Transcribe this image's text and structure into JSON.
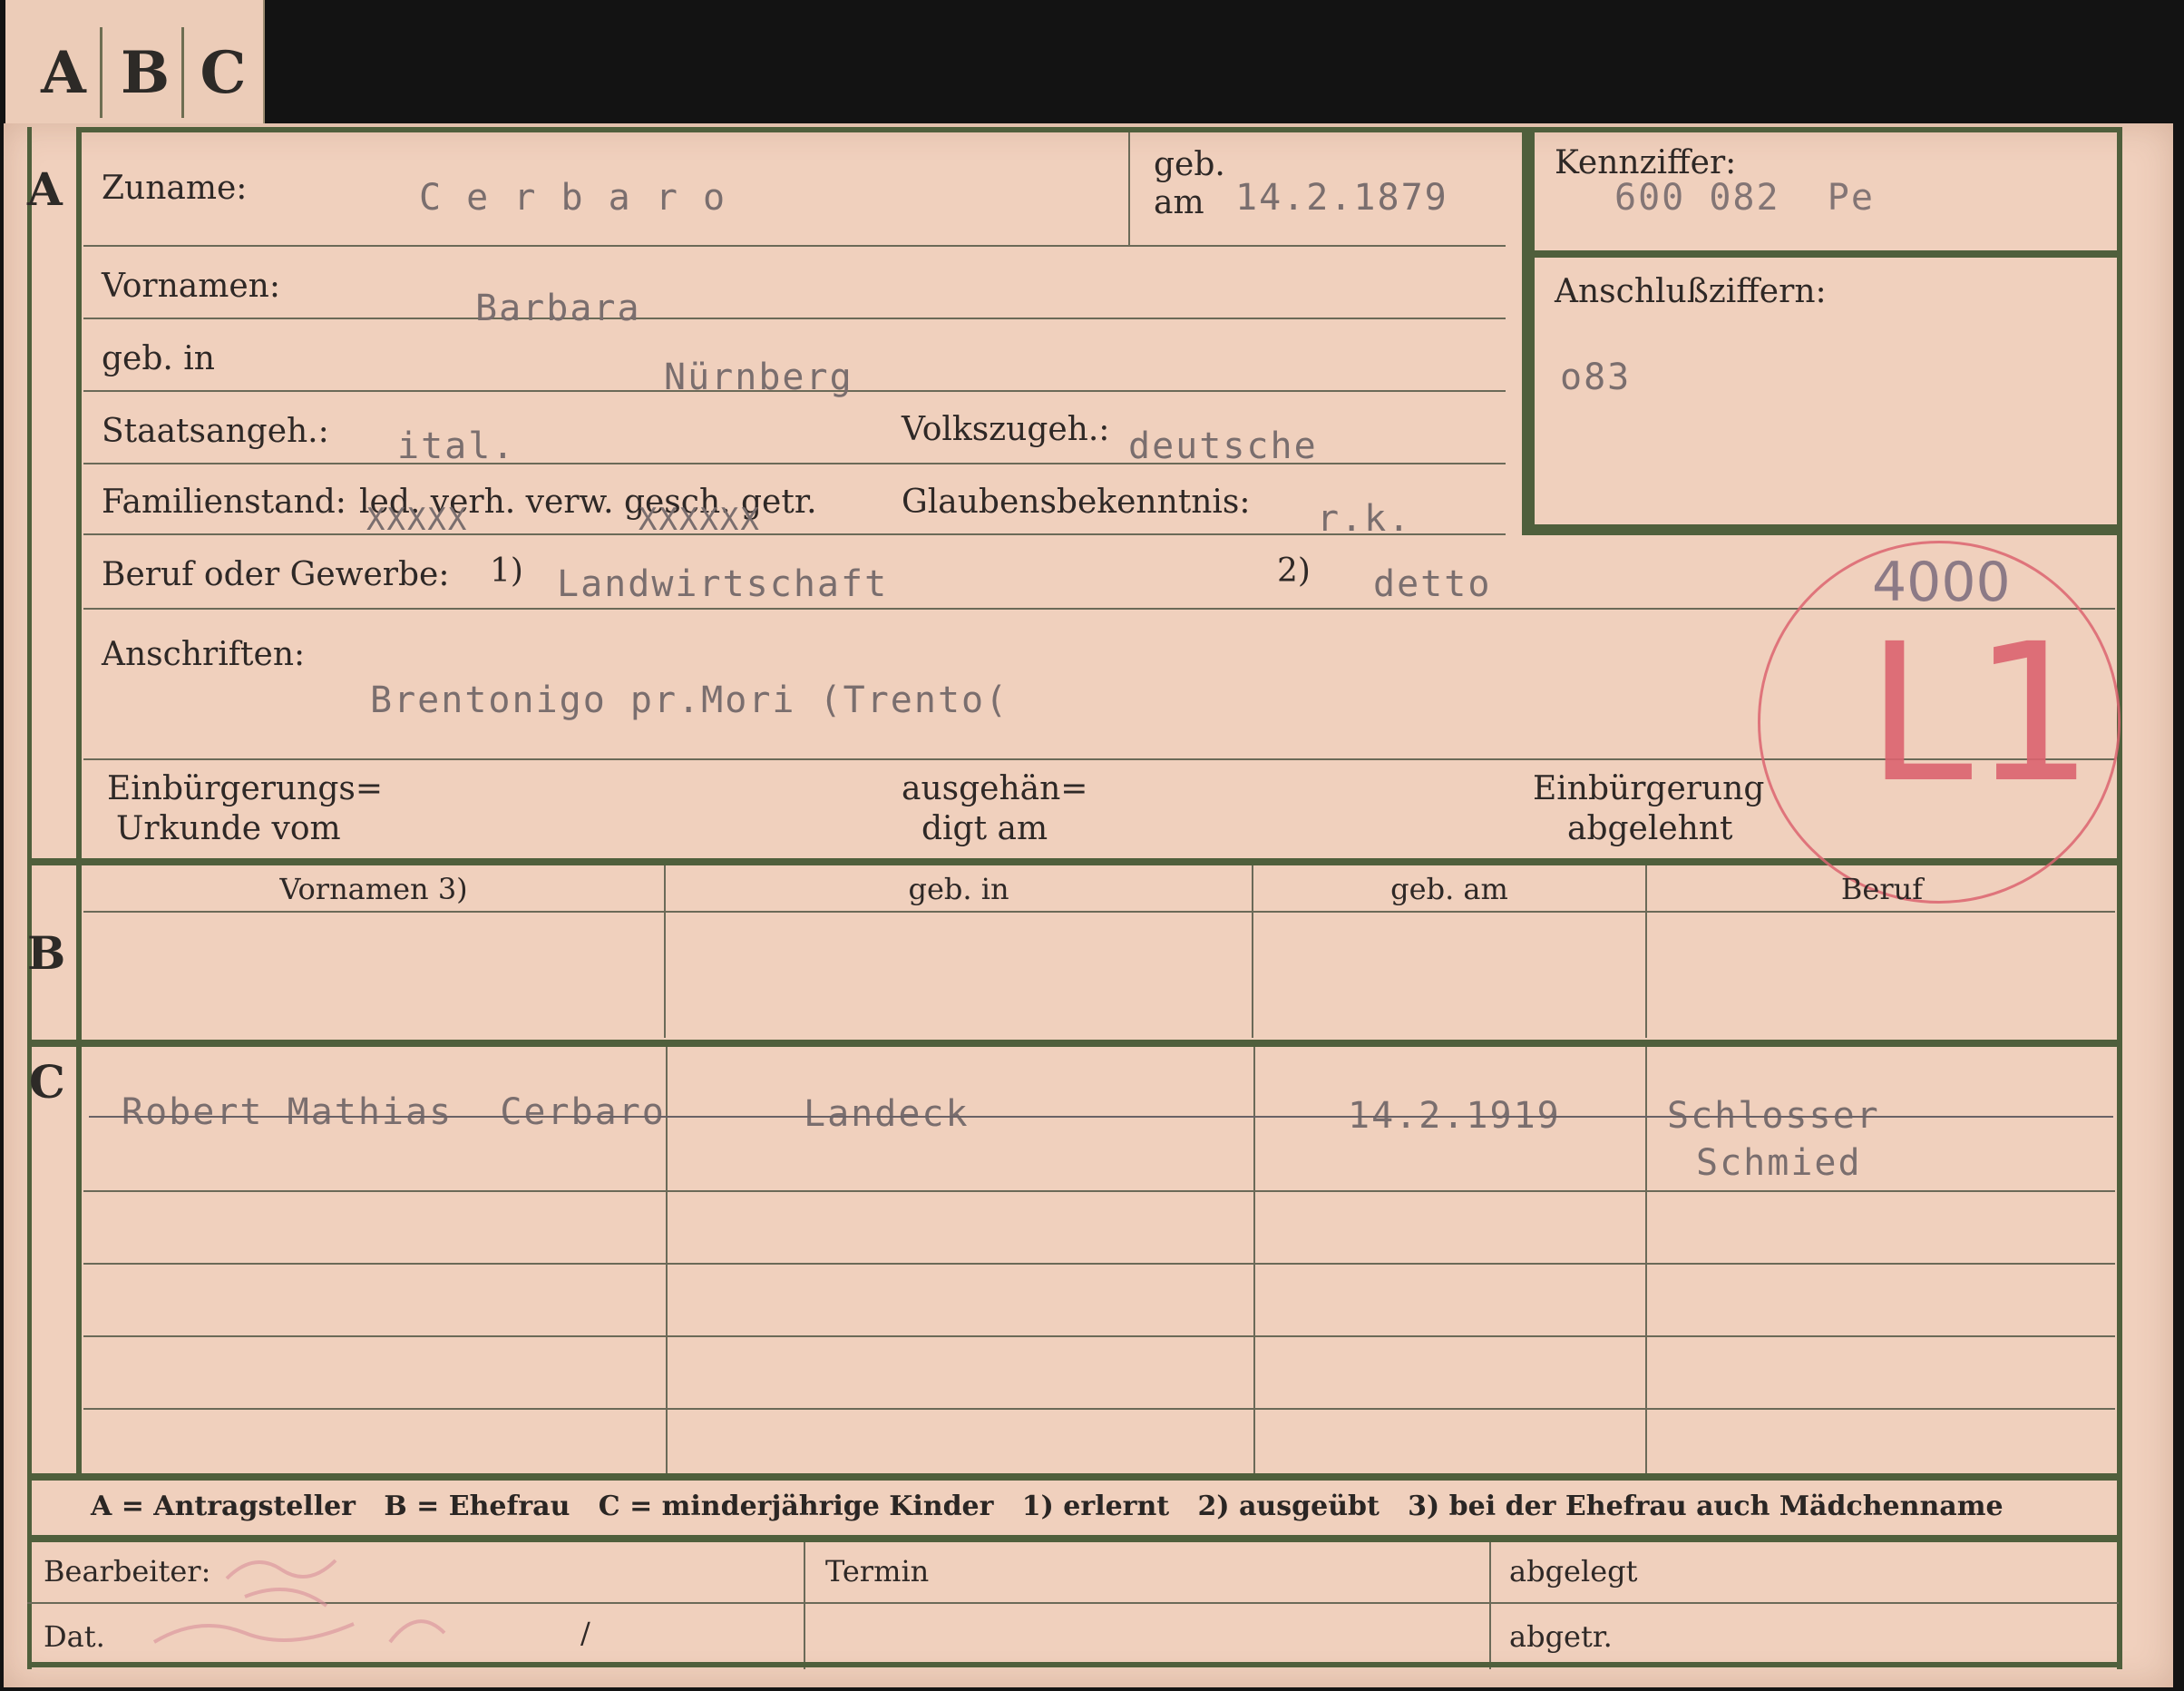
{
  "tabs": [
    "A",
    "B",
    "C"
  ],
  "section_a": {
    "letter": "A",
    "surname_label": "Zuname:",
    "surname_value": "C e r b a r o",
    "birth_label_1": "geb.",
    "birth_label_2": "am",
    "birth_value": "14.2.1879",
    "id_label": "Kennziffer:",
    "id_value": "600 082  Pe",
    "attach_label": "Anschlußziffern:",
    "attach_value": "o83",
    "firstnames_label": "Vornamen:",
    "firstnames_value": "Barbara",
    "birthplace_label": "geb. in",
    "birthplace_value": "Nürnberg",
    "citizenship_label": "Staatsangeh.:",
    "citizenship_value": "ital.",
    "ethnicity_label": "Volkszugeh.:",
    "ethnicity_value": "deutsche",
    "marital_label": "Familienstand:",
    "marital_options": "led. verh. verw. gesch. getr.",
    "marital_strike_1": "XXXXX",
    "marital_strike_2": "XXXXXX",
    "religion_label": "Glaubensbekenntnis:",
    "religion_value": "r.k.",
    "profession_label": "Beruf oder Gewerbe:",
    "profession_mark_1": "1)",
    "profession_value_1": "Landwirtschaft",
    "profession_mark_2": "2)",
    "profession_value_2": "detto",
    "address_label": "Anschriften:",
    "address_value": "Brentonigo pr.Mori (Trento(",
    "naturalization_doc_label_1": "Einbürgerungs=",
    "naturalization_doc_label_2": "Urkunde vom",
    "handed_label_1": "ausgehän=",
    "handed_label_2": "digt am",
    "naturalization_rejected_label_1": "Einbürgerung",
    "naturalization_rejected_label_2": "abgelehnt"
  },
  "stamp": {
    "number": "4000",
    "code": "L1",
    "color": "#d8606a"
  },
  "section_b": {
    "letter": "B",
    "columns": [
      "Vornamen 3)",
      "geb. in",
      "geb. am",
      "Beruf"
    ]
  },
  "section_c": {
    "letter": "C",
    "child_name": "Robert Mathias  Cerbaro",
    "child_birthplace": "Landeck",
    "child_birthdate": "14.2.1919",
    "child_profession_1": "Schlosser",
    "child_profession_2": "Schmied"
  },
  "legend": "A = Antragsteller   B = Ehefrau   C = minderjährige Kinder   1) erlernt   2) ausgeübt   3) bei der Ehefrau auch Mädchenname",
  "footer": {
    "clerk_label": "Bearbeiter:",
    "date_label": "Dat.",
    "date_slash": "/",
    "deadline_label": "Termin",
    "filed_label": "abgelegt",
    "sent_label": "abgetr."
  },
  "colors": {
    "card": "#f0d0bd",
    "frame": "#4f5f3c",
    "typewriter": "#7a6e6e",
    "background": "#131313"
  }
}
